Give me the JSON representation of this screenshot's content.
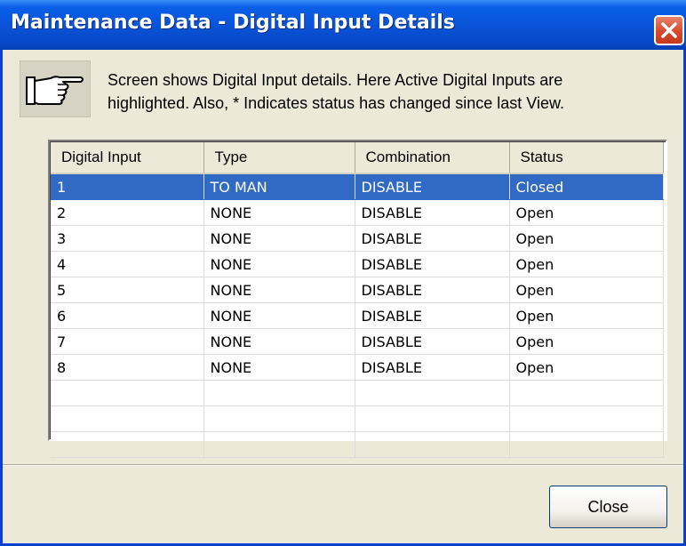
{
  "window": {
    "title": "Maintenance Data - Digital Input Details",
    "close_icon": "close-x-icon"
  },
  "intro": {
    "icon": "pointing-hand-icon",
    "line1": "Screen shows Digital Input details. Here Active Digital Inputs are",
    "line2": "highlighted.  Also,  *  Indicates status has changed since last View."
  },
  "table": {
    "columns": [
      "Digital Input",
      "Type",
      "Combination",
      "Status"
    ],
    "rows": [
      {
        "input": "1",
        "type": "TO MAN",
        "combination": "DISABLE",
        "status": "Closed",
        "selected": true
      },
      {
        "input": "2",
        "type": "NONE",
        "combination": "DISABLE",
        "status": "Open"
      },
      {
        "input": "3",
        "type": "NONE",
        "combination": "DISABLE",
        "status": "Open"
      },
      {
        "input": "4",
        "type": "NONE",
        "combination": "DISABLE",
        "status": "Open"
      },
      {
        "input": "5",
        "type": "NONE",
        "combination": "DISABLE",
        "status": "Open"
      },
      {
        "input": "6",
        "type": "NONE",
        "combination": "DISABLE",
        "status": "Open"
      },
      {
        "input": "7",
        "type": "NONE",
        "combination": "DISABLE",
        "status": "Open"
      },
      {
        "input": "8",
        "type": "NONE",
        "combination": "DISABLE",
        "status": "Open"
      }
    ],
    "selected_row_color": "#316ac5"
  },
  "footer": {
    "close_label": "Close"
  }
}
